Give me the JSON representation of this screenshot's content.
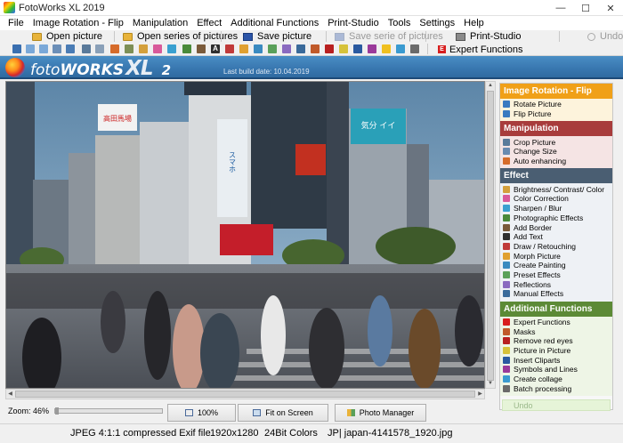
{
  "window": {
    "title": "FotoWorks XL 2019"
  },
  "menu": [
    "File",
    "Image Rotation - Flip",
    "Manipulation",
    "Effect",
    "Additional Functions",
    "Print-Studio",
    "Tools",
    "Settings",
    "Help"
  ],
  "toolbar": {
    "open_picture": "Open picture",
    "open_series": "Open series of pictures",
    "save_picture": "Save picture",
    "save_series": "Save serie of pictures",
    "print_studio": "Print-Studio",
    "undo": "Undo",
    "expert_functions": "Expert Functions",
    "expert_badge": "E"
  },
  "logo": {
    "foto": "foto",
    "works": "WORKS",
    "xl": "XL",
    "version": "2",
    "build": "Last build date: 10.04.2019"
  },
  "panel": {
    "sections": [
      {
        "title": "Image Rotation - Flip",
        "color": "#f0a018",
        "items": [
          "Rotate Picture",
          "Flip Picture"
        ]
      },
      {
        "title": "Manipulation",
        "color": "#a83c3c",
        "items": [
          "Crop Picture",
          "Change Size",
          "Auto enhancing"
        ]
      },
      {
        "title": "Effect",
        "color": "#4a5e72",
        "items": [
          "Brightness/ Contrast/ Color",
          "Color Correction",
          "Sharpen / Blur",
          "Photographic Effects",
          "Add Border",
          "Add Text",
          "Draw / Retouching",
          "Morph Picture",
          "Create Painting",
          "Preset Effects",
          "Reflections",
          "Manual Effects"
        ]
      },
      {
        "title": "Additional Functions",
        "color": "#5c8a36",
        "items": [
          "Expert Functions",
          "Masks",
          "Remove red eyes",
          "Picture in Picture",
          "Insert Cliparts",
          "Symbols and Lines",
          "Create collage",
          "Batch processing"
        ]
      }
    ],
    "undo": "Undo"
  },
  "zoom": {
    "label": "Zoom: 46%",
    "percent": 46
  },
  "buttons": {
    "zoom100": "100%",
    "fit": "Fit on Screen",
    "photo_manager": "Photo Manager"
  },
  "status": {
    "format": "JPEG 4:1:1 compressed Exif file",
    "dimensions": "1920x1280",
    "colors": "24Bit Colors",
    "filename": "JP| japan-4141578_1920.jpg"
  },
  "photo_signs": {
    "billboard_left": "高田馬場",
    "vert_sign": "スマホ",
    "right_sign": "気分 イイ"
  }
}
